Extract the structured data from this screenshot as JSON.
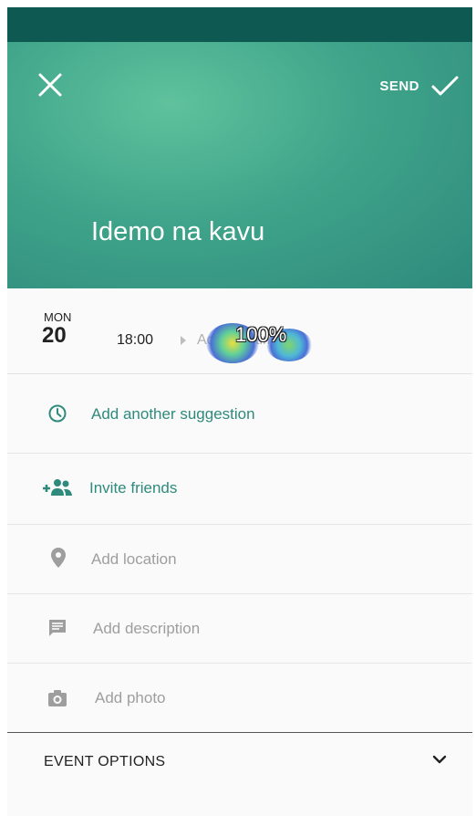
{
  "header": {
    "close_icon": "close-icon",
    "send_label": "SEND",
    "send_icon": "check-icon",
    "title": "Idemo na kavu",
    "color": "#3fa48a",
    "status_bar_color": "#0e5a53"
  },
  "date": {
    "day_name": "MON",
    "day_number": "20",
    "time": "18:00",
    "end_time_placeholder": "Add end time"
  },
  "overlay": {
    "label": "100%"
  },
  "actions": {
    "suggestion": {
      "label": "Add another suggestion",
      "icon": "clock-icon"
    },
    "invite": {
      "label": "Invite friends",
      "icon": "add-people-icon"
    },
    "location": {
      "label": "Add location",
      "icon": "location-pin-icon"
    },
    "description": {
      "label": "Add description",
      "icon": "description-icon"
    },
    "photo": {
      "label": "Add photo",
      "icon": "camera-icon"
    }
  },
  "options": {
    "label": "EVENT OPTIONS",
    "icon": "chevron-down-icon"
  },
  "colors": {
    "accent": "#2e8a7c",
    "placeholder_text": "#9e9e9e"
  }
}
